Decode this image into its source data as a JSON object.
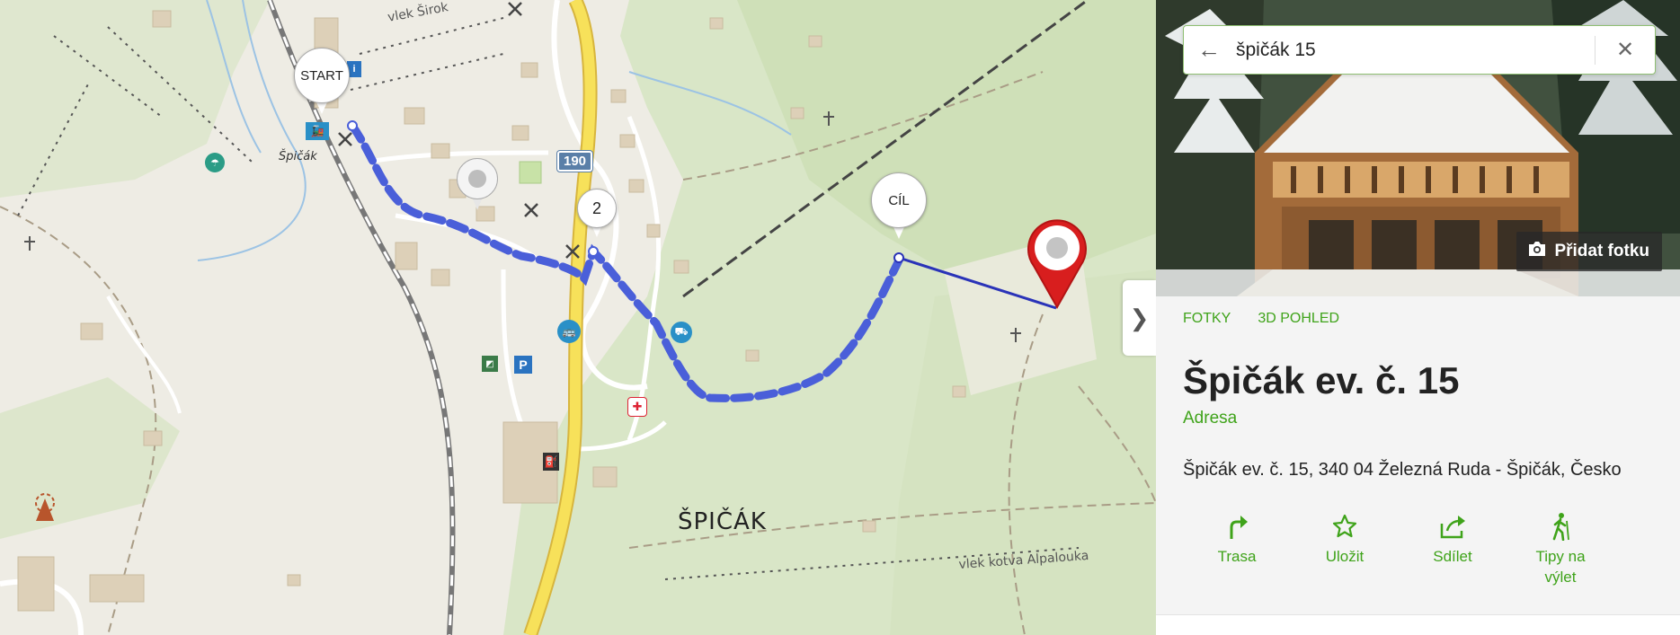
{
  "map": {
    "town_label": "ŠPIČÁK",
    "station_label": "Špičák",
    "lift_top_label": "vlek Širok",
    "lift_bottom_label": "vlek kotva Alpalouka",
    "road_number": "190",
    "start_label": "START",
    "waypoint_label": "2",
    "finish_label": "CÍL",
    "route_color": "#4a5fd9",
    "marker_color": "#d81e1e",
    "collapse_icon": "chevron-right-icon"
  },
  "panel": {
    "search": {
      "value": "špičák 15",
      "back_icon": "arrow-left-icon",
      "clear_icon": "close-icon"
    },
    "add_photo_label": "Přidat fotku",
    "tabs": [
      "FOTKY",
      "3D POHLED"
    ],
    "title": "Špičák ev. č. 15",
    "subtitle": "Adresa",
    "address": "Špičák ev. č. 15, 340 04 Železná Ruda - Špičák, Česko",
    "actions": [
      {
        "label": "Trasa",
        "icon": "route-arrow-icon"
      },
      {
        "label": "Uložit",
        "icon": "star-icon"
      },
      {
        "label": "Sdílet",
        "icon": "share-icon"
      },
      {
        "label": "Tipy na výlet",
        "icon": "hiker-icon"
      }
    ],
    "accent_color": "#3fa31a"
  }
}
